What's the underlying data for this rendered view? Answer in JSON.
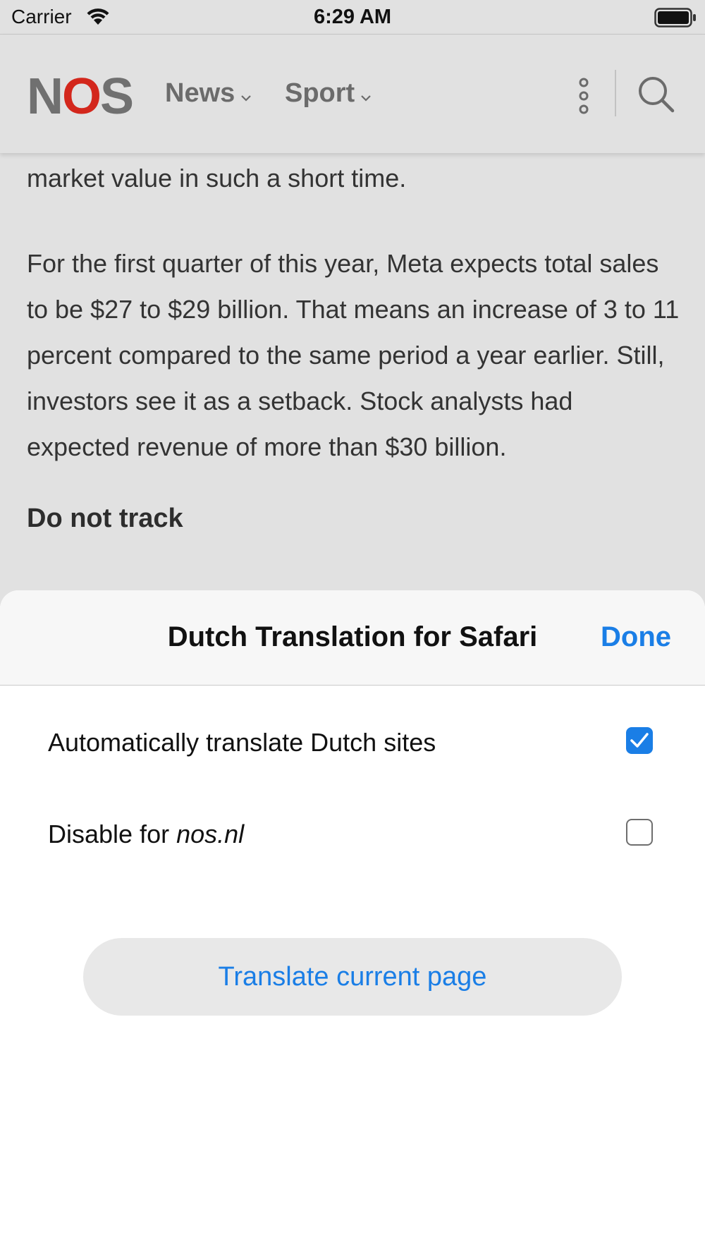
{
  "status_bar": {
    "carrier": "Carrier",
    "time": "6:29 AM"
  },
  "navbar": {
    "logo_parts": [
      "N",
      "O",
      "S"
    ],
    "logo_colors": {
      "letters": "#707070",
      "o": "#d3271c"
    },
    "items": [
      {
        "label": "News"
      },
      {
        "label": "Sport"
      }
    ]
  },
  "article": {
    "p1": "market value in such a short time.",
    "p2": "For the first quarter of this year, Meta expects total sales to be $27 to $29 billion. That means an increase of 3 to 11 percent compared to the same period a year earlier. Still, investors see it as a setback. Stock analysts had expected revenue of more than $30 billion.",
    "heading": "Do not track"
  },
  "sheet": {
    "title": "Dutch Translation for Safari",
    "done_label": "Done",
    "options": [
      {
        "label": "Automatically translate Dutch sites",
        "checked": true
      },
      {
        "label_prefix": "Disable for ",
        "label_domain": "nos.nl",
        "checked": false
      }
    ],
    "translate_button": "Translate current page",
    "accent_color": "#1a7ee6"
  }
}
